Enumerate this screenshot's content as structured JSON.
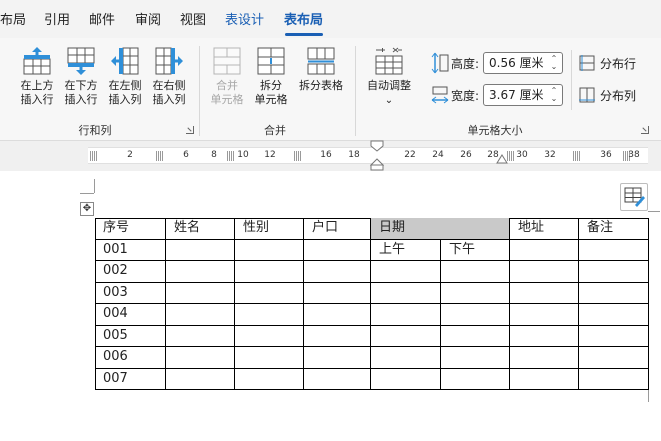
{
  "tabs": [
    {
      "label": "布局",
      "id": "layout"
    },
    {
      "label": "引用",
      "id": "references"
    },
    {
      "label": "邮件",
      "id": "mailings"
    },
    {
      "label": "审阅",
      "id": "review"
    },
    {
      "label": "视图",
      "id": "view"
    },
    {
      "label": "表设计",
      "id": "table-design"
    },
    {
      "label": "表布局",
      "id": "table-layout"
    }
  ],
  "ribbon": {
    "rows_cols": {
      "group_label": "行和列",
      "insert_above": [
        "在上方",
        "插入行"
      ],
      "insert_below": [
        "在下方",
        "插入行"
      ],
      "insert_left": [
        "在左侧",
        "插入列"
      ],
      "insert_right": [
        "在右侧",
        "插入列"
      ]
    },
    "merge": {
      "group_label": "合并",
      "merge_cells": [
        "合并",
        "单元格"
      ],
      "split_cells": [
        "拆分",
        "单元格"
      ],
      "split_table": "拆分表格"
    },
    "cell_size": {
      "group_label": "单元格大小",
      "autofit": "自动调整",
      "autofit_arrow": "⌄",
      "height_label": "高度:",
      "height_value": "0.56 厘米",
      "width_label": "宽度:",
      "width_value": "3.67 厘米",
      "distribute_rows": "分布行",
      "distribute_cols": "分布列"
    }
  },
  "ruler": {
    "numbers": [
      "2",
      "6",
      "8",
      "10",
      "12",
      "16",
      "18",
      "22",
      "24",
      "26",
      "28",
      "30",
      "32",
      "36",
      "38"
    ]
  },
  "table": {
    "header": [
      "序号",
      "姓名",
      "性别",
      "户口",
      "日期",
      "地址",
      "备注"
    ],
    "subheader": [
      "上午",
      "下午"
    ],
    "row_ids": [
      "001",
      "002",
      "003",
      "004",
      "005",
      "006",
      "007"
    ],
    "shaded_color": "#c9c9c9"
  },
  "colors": {
    "accent": "#1a5fb4",
    "ribbon_bg": "#f7f7f7",
    "icon_blue": "#2f8fd8"
  }
}
